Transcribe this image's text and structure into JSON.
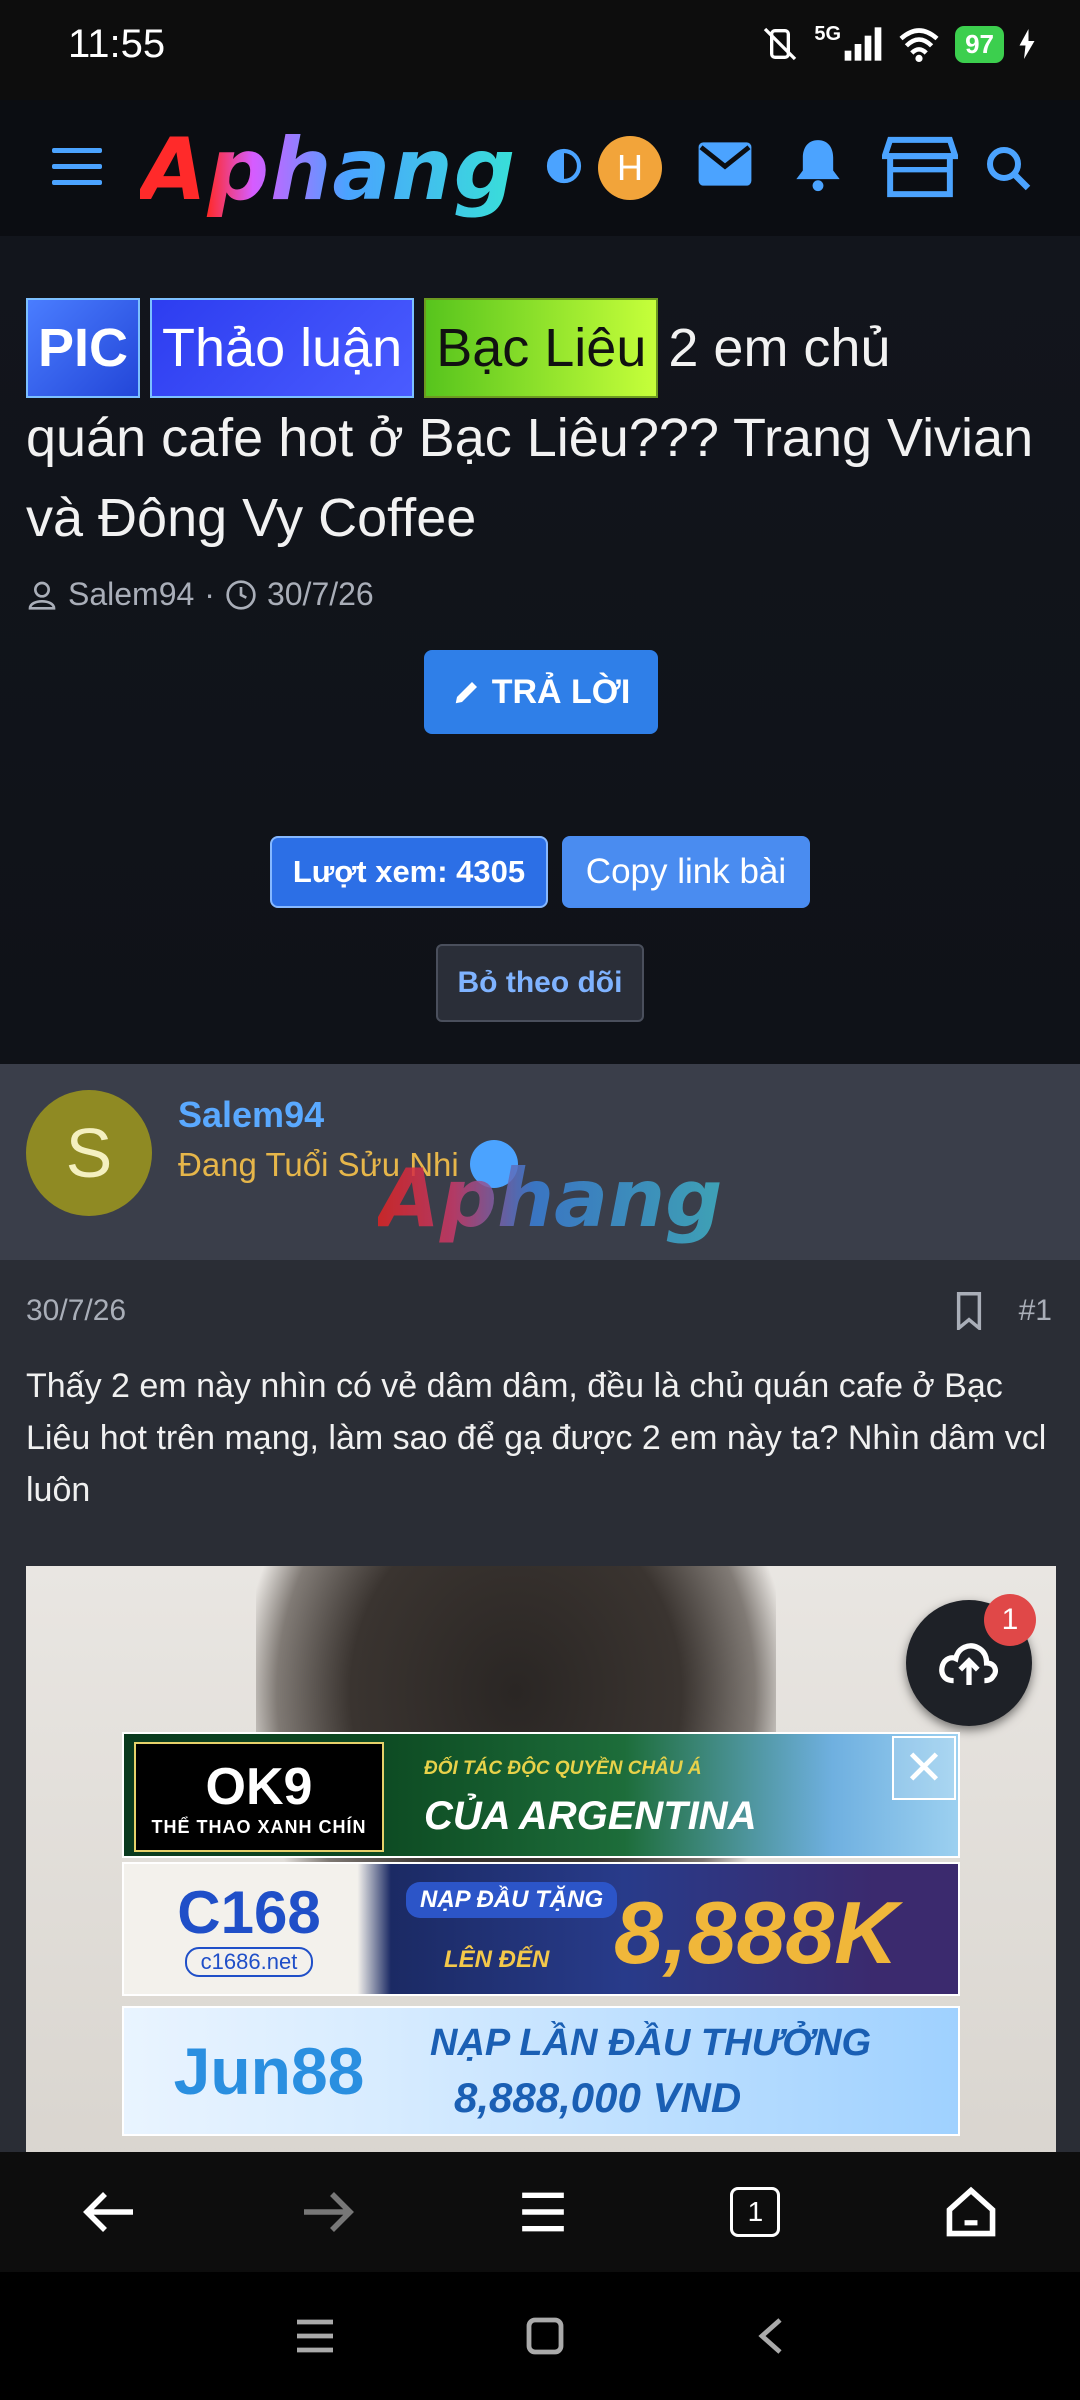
{
  "status_bar": {
    "time": "11:55",
    "network": "5G",
    "battery": "97"
  },
  "header": {
    "logo": "Aphang",
    "avatar_letter": "H"
  },
  "thread": {
    "tags": [
      "PIC",
      "Thảo luận",
      "Bạc Liêu"
    ],
    "title_tail": "2 em chủ",
    "title_rest": "quán cafe hot ở Bạc Liêu??? Trang Vivian và Đông Vy Coffee",
    "author": "Salem94",
    "date": "30/7/26",
    "reply_label": "TRẢ LỜI",
    "views_label": "Lượt xem: 4305",
    "copy_label": "Copy link bài",
    "unfollow_label": "Bỏ theo dõi"
  },
  "post": {
    "avatar_letter": "S",
    "author": "Salem94",
    "rank": "Đang Tuổi Sửu Nhi",
    "watermark": "Aphang",
    "date": "30/7/26",
    "number": "#1",
    "body": "Thấy 2 em này nhìn có vẻ dâm dâm, đều là chủ quán cafe ở Bạc Liêu hot trên mạng, làm sao để gạ được 2 em này ta? Nhìn dâm vcl luôn"
  },
  "fab": {
    "badge": "1"
  },
  "ads": [
    {
      "logo": "OK9",
      "logo_sub": "THỂ THAO XANH CHÍN",
      "line1": "ĐỐI TÁC ĐỘC QUYỀN CHÂU Á",
      "line2": "CỦA ARGENTINA"
    },
    {
      "logo": "C168",
      "logo_sub": "c1686.net",
      "line1": "NẠP ĐẦU TẶNG",
      "line2": "LÊN ĐẾN",
      "amount": "8,888K"
    },
    {
      "logo": "Jun88",
      "line1": "NẠP LẦN ĐẦU THƯỞNG",
      "line2": "8,888,000 VND"
    }
  ],
  "toolbar": {
    "tabs_count": "1"
  },
  "colors": {
    "accent": "#2f7fe8",
    "link": "#5aa9ff",
    "rank": "#e6b64a"
  }
}
